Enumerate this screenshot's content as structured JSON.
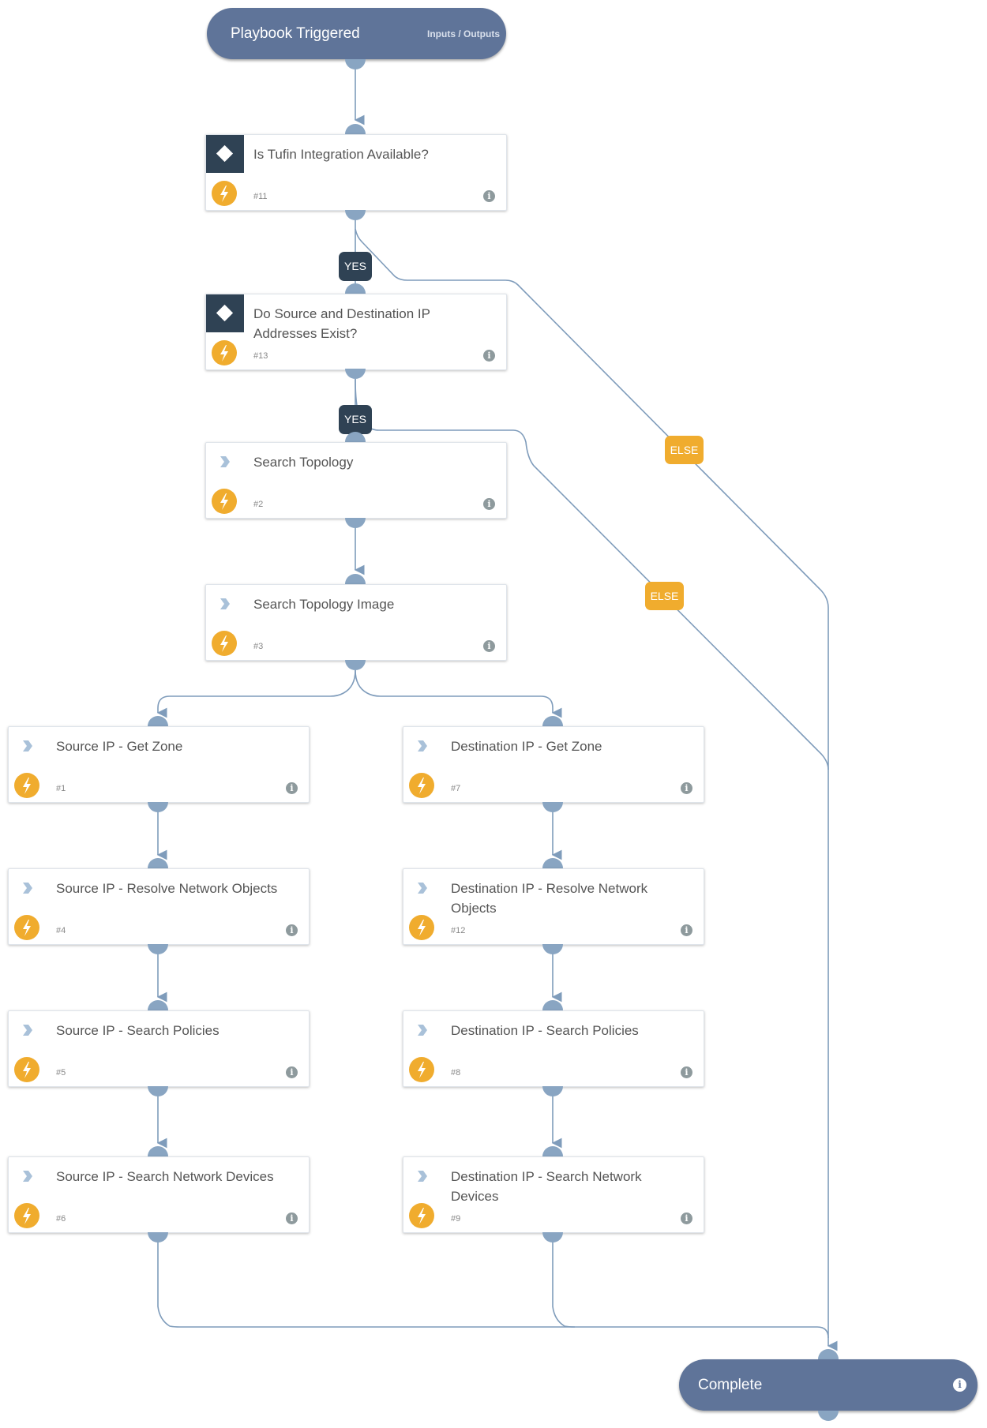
{
  "start": {
    "title": "Playbook Triggered",
    "io_link": "Inputs / Outputs"
  },
  "end": {
    "title": "Complete",
    "info_icon": "info-icon"
  },
  "tasks": [
    {
      "id": "11",
      "number": "#11",
      "label": "Is Tufin Integration Available?",
      "type": "condition"
    },
    {
      "id": "13",
      "number": "#13",
      "label": "Do Source and Destination IP Addresses Exist?",
      "type": "condition"
    },
    {
      "id": "2",
      "number": "#2",
      "label": "Search Topology",
      "type": "playbook"
    },
    {
      "id": "3",
      "number": "#3",
      "label": "Search Topology Image",
      "type": "playbook"
    },
    {
      "id": "1",
      "number": "#1",
      "label": "Source IP - Get Zone",
      "type": "playbook"
    },
    {
      "id": "7",
      "number": "#7",
      "label": "Destination IP - Get Zone",
      "type": "playbook"
    },
    {
      "id": "4",
      "number": "#4",
      "label": "Source IP - Resolve Network Objects",
      "type": "playbook"
    },
    {
      "id": "12",
      "number": "#12",
      "label": "Destination IP - Resolve Network Objects",
      "type": "playbook"
    },
    {
      "id": "5",
      "number": "#5",
      "label": "Source IP - Search Policies",
      "type": "playbook"
    },
    {
      "id": "8",
      "number": "#8",
      "label": "Destination IP - Search Policies",
      "type": "playbook"
    },
    {
      "id": "6",
      "number": "#6",
      "label": "Source IP - Search Network Devices",
      "type": "playbook"
    },
    {
      "id": "9",
      "number": "#9",
      "label": "Destination IP - Search Network Devices",
      "type": "playbook"
    }
  ],
  "branches": {
    "yes1": "YES",
    "yes2": "YES",
    "else1": "ELSE",
    "else2": "ELSE"
  },
  "colors": {
    "pill": "#5f7499",
    "condition": "#2f4254",
    "automation": "#f0ac2e",
    "connector": "#89a5c2",
    "wire": "#7f9cbb"
  }
}
